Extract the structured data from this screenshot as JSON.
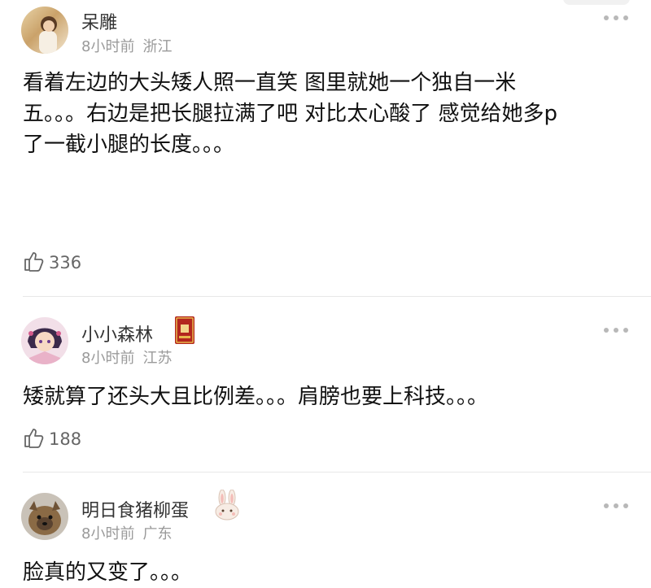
{
  "comments": [
    {
      "name": "呆雕",
      "time": "8小时前",
      "location": "浙江",
      "lines": [
        "看着左边的大头矮人照一直笑 图里就她一个独自一米",
        "五。。。右边是把长腿拉满了吧 对比太心酸了 感觉给她多p",
        "了一截小腿的长度。。。"
      ],
      "likes": "336"
    },
    {
      "name": "小小森林",
      "time": "8小时前",
      "location": "江苏",
      "lines": [
        "矮就算了还头大且比例差。。。肩膀也要上科技。。。"
      ],
      "likes": "188"
    },
    {
      "name": "明日食猪柳蛋",
      "time": "8小时前",
      "location": "广东",
      "lines": [
        "脸真的又变了。。。"
      ],
      "likes": ""
    }
  ],
  "colors": {
    "text": "#111111",
    "meta": "#9a9a9a",
    "divider": "#e8e8e8"
  },
  "icons": [
    "thumbs-up-icon",
    "more-icon",
    "book-badge-icon",
    "rabbit-badge-icon"
  ]
}
